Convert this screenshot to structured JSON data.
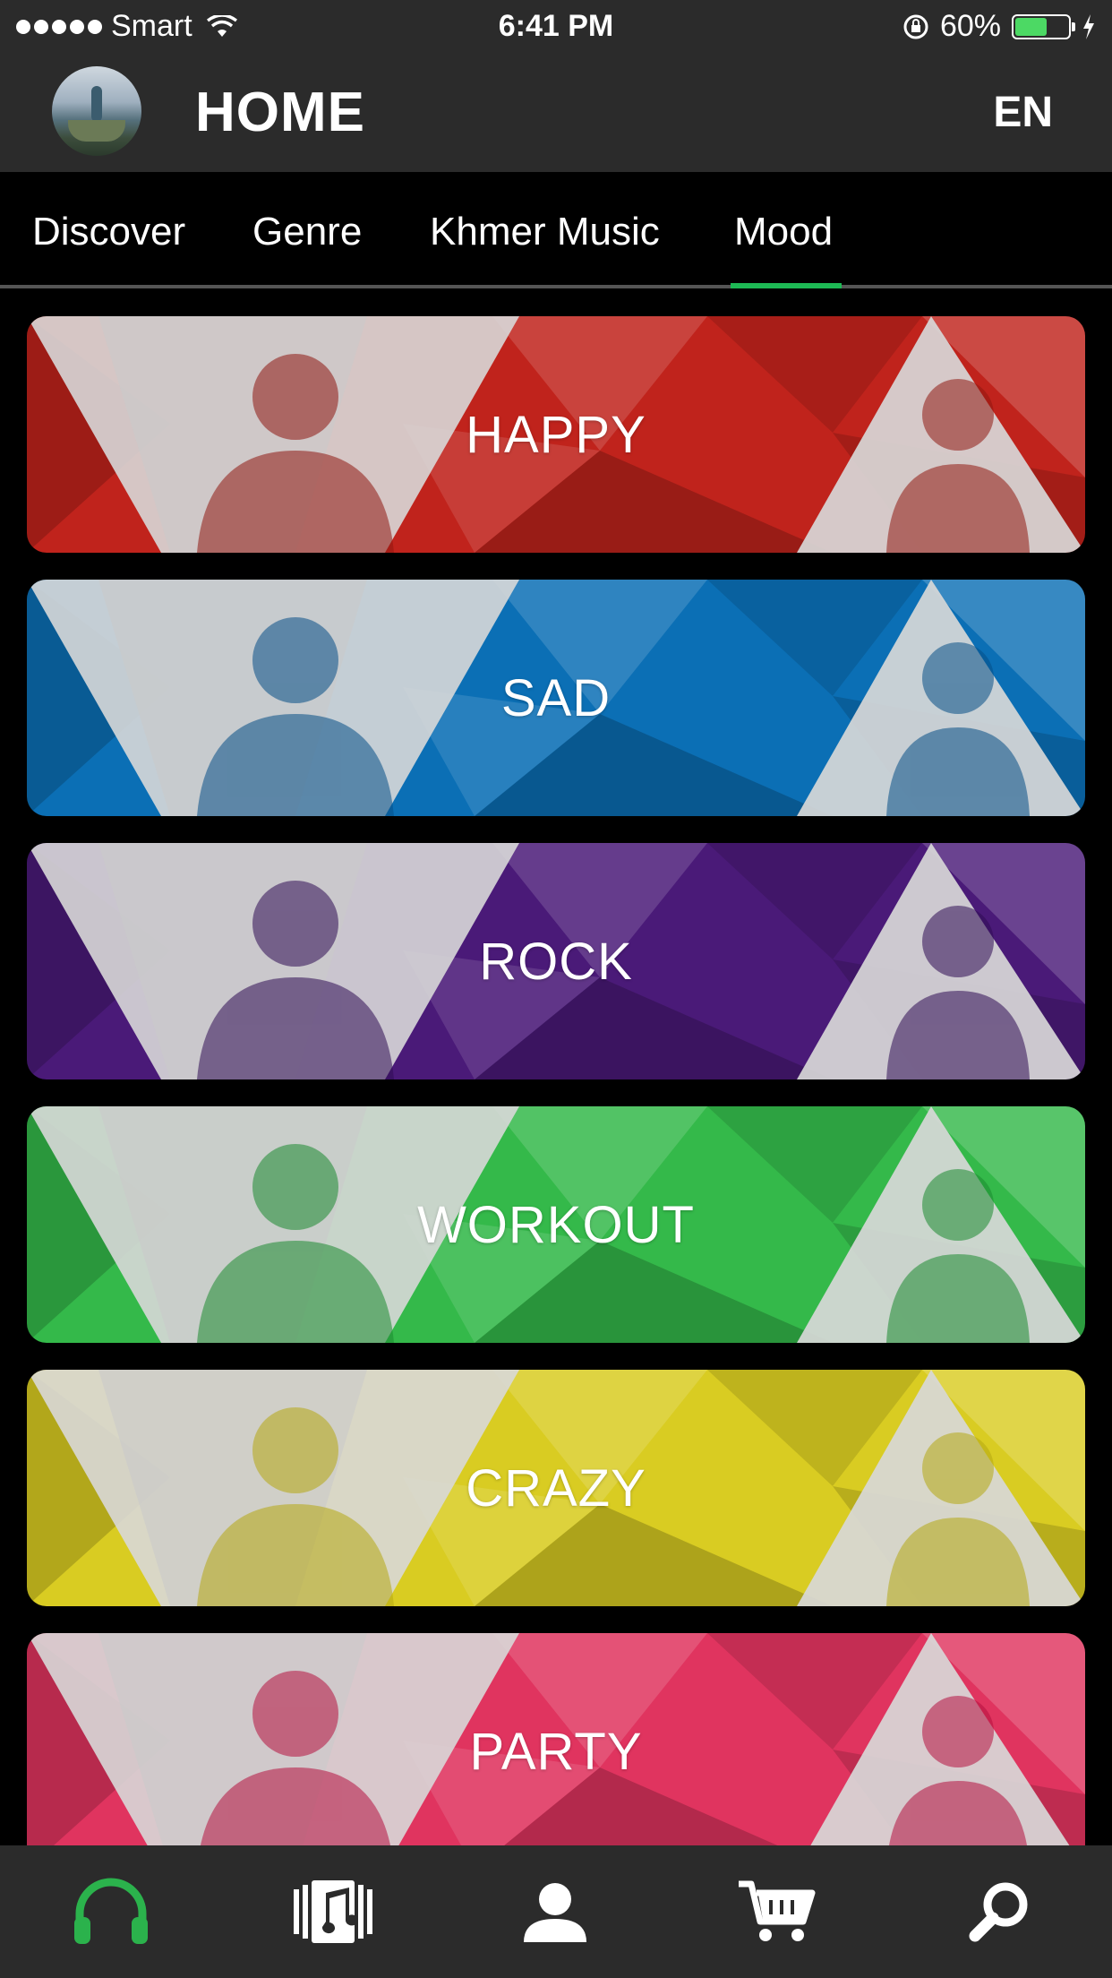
{
  "status_bar": {
    "carrier": "Smart",
    "time": "6:41 PM",
    "battery_percent": "60%",
    "battery_level": 0.6
  },
  "header": {
    "title": "HOME",
    "language": "EN"
  },
  "tabs": [
    {
      "label": "Discover",
      "active": false
    },
    {
      "label": "Genre",
      "active": false
    },
    {
      "label": "Khmer Music",
      "active": false
    },
    {
      "label": "Mood",
      "active": true
    }
  ],
  "moods": [
    {
      "label": "HAPPY",
      "color": "#c0231c",
      "dark": "#8f1711"
    },
    {
      "label": "SAD",
      "color": "#0b6fb5",
      "dark": "#064e86"
    },
    {
      "label": "ROCK",
      "color": "#4a1a78",
      "dark": "#2f0c54"
    },
    {
      "label": "WORKOUT",
      "color": "#34b94a",
      "dark": "#1c8a30"
    },
    {
      "label": "CRAZY",
      "color": "#d9cc22",
      "dark": "#b5a812"
    },
    {
      "label": "PARTY",
      "color": "#e0345f",
      "dark": "#b5103f"
    }
  ],
  "bottom_nav": [
    {
      "icon": "headphones-icon",
      "active": true
    },
    {
      "icon": "music-library-icon",
      "active": false
    },
    {
      "icon": "profile-icon",
      "active": false
    },
    {
      "icon": "cart-icon",
      "active": false
    },
    {
      "icon": "search-icon",
      "active": false
    }
  ],
  "colors": {
    "accent": "#1db954",
    "bar_background": "#2b2b2b"
  }
}
